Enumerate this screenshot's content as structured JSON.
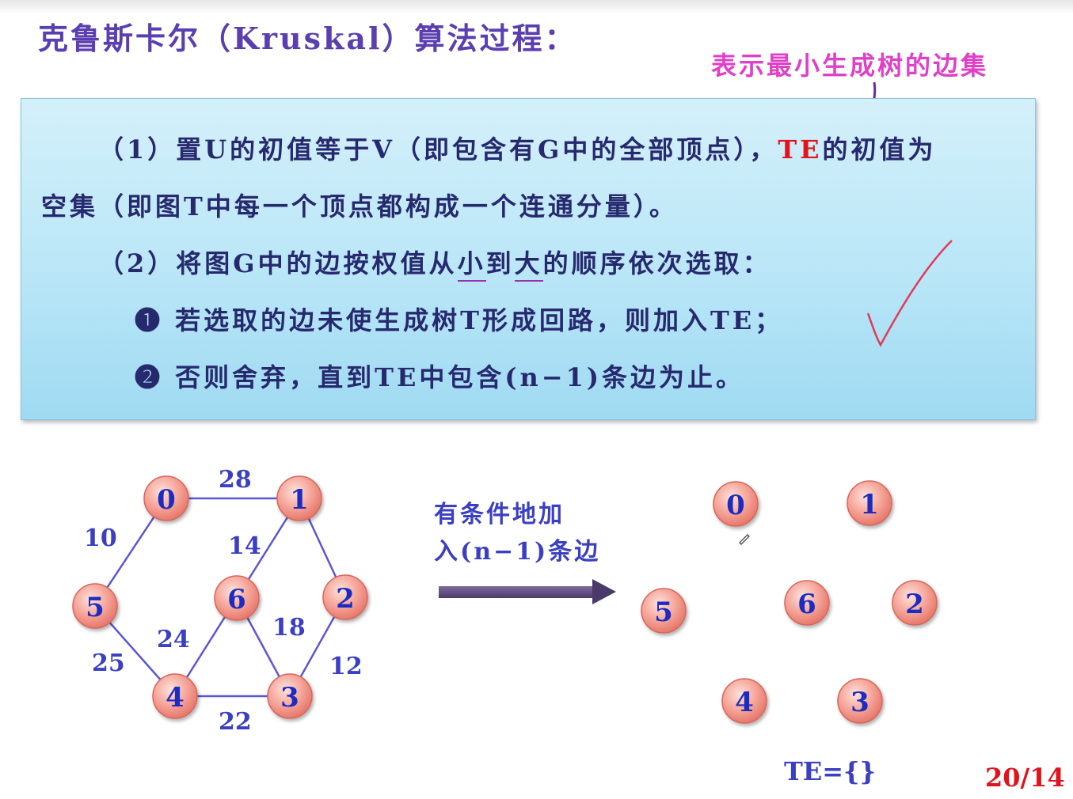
{
  "title": "克鲁斯卡尔（Kruskal）算法过程：",
  "annotation": "表示最小生成树的边集",
  "steps": {
    "l1_pre": "（1）置U的初值等于V（即包含有G中的全部顶点），",
    "l1_te": "TE",
    "l1_post": "的初值为",
    "l2": "空集（即图T中每一个顶点都构成一个连通分量）。",
    "l3_pre": "（2）将图G中的边按权值从",
    "l3_u1": "小",
    "l3_mid": "到",
    "l3_u2": "大",
    "l3_post": "的顺序依次选取：",
    "l4": "❶ 若选取的边未使生成树T形成回路，则加入TE；",
    "l5": "❷ 否则舍弃，直到TE中包含(n−1)条边为止。"
  },
  "arrow_text": {
    "line1": "有条件地加",
    "line2": "入(n−1)条边"
  },
  "left_graph": {
    "nodes": [
      "0",
      "1",
      "2",
      "3",
      "4",
      "5",
      "6"
    ],
    "weights": [
      "28",
      "10",
      "14",
      "18",
      "12",
      "24",
      "25",
      "22"
    ]
  },
  "right_graph": {
    "nodes": [
      "0",
      "1",
      "2",
      "3",
      "4",
      "5",
      "6"
    ]
  },
  "te_label": "TE={}",
  "page_number": "20/14",
  "colors": {
    "title": "#5a3fb0",
    "annotation": "#e040c8",
    "accent_red": "#e1141e",
    "node_fill": "#f6a79c",
    "edge": "#5a56d6"
  }
}
